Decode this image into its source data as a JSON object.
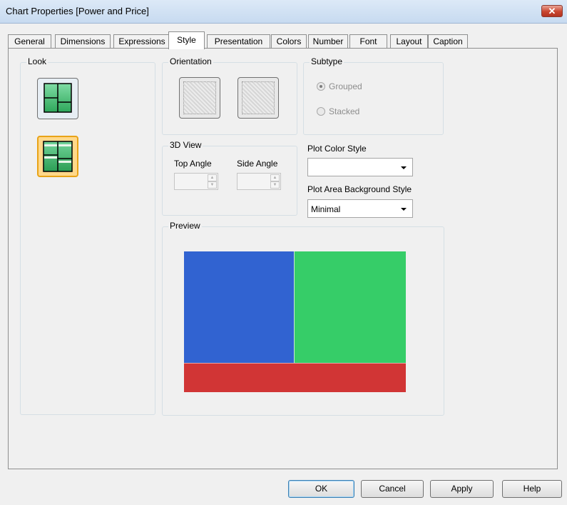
{
  "window": {
    "title": "Chart Properties [Power and Price]",
    "close_label": "✕"
  },
  "tabs": [
    {
      "label": "General"
    },
    {
      "label": "Dimensions"
    },
    {
      "label": "Expressions"
    },
    {
      "label": "Style"
    },
    {
      "label": "Presentation"
    },
    {
      "label": "Colors"
    },
    {
      "label": "Number"
    },
    {
      "label": "Font"
    },
    {
      "label": "Layout"
    },
    {
      "label": "Caption"
    }
  ],
  "active_tab": "Style",
  "look": {
    "label": "Look",
    "selected": "second"
  },
  "orientation": {
    "label": "Orientation"
  },
  "subtype": {
    "label": "Subtype",
    "options": [
      "Grouped",
      "Stacked"
    ],
    "selected": "Grouped",
    "enabled": false
  },
  "view3d": {
    "label": "3D View",
    "top_angle_label": "Top Angle",
    "side_angle_label": "Side Angle",
    "top_angle_value": "",
    "side_angle_value": ""
  },
  "plot_color_style": {
    "label": "Plot Color Style",
    "value": ""
  },
  "plot_area_bg": {
    "label": "Plot Area Background Style",
    "value": "Minimal"
  },
  "preview": {
    "label": "Preview",
    "colors": {
      "blue": "#3163d1",
      "green": "#36cd68",
      "red": "#d13535"
    }
  },
  "buttons": {
    "ok": "OK",
    "cancel": "Cancel",
    "apply": "Apply",
    "help": "Help"
  }
}
